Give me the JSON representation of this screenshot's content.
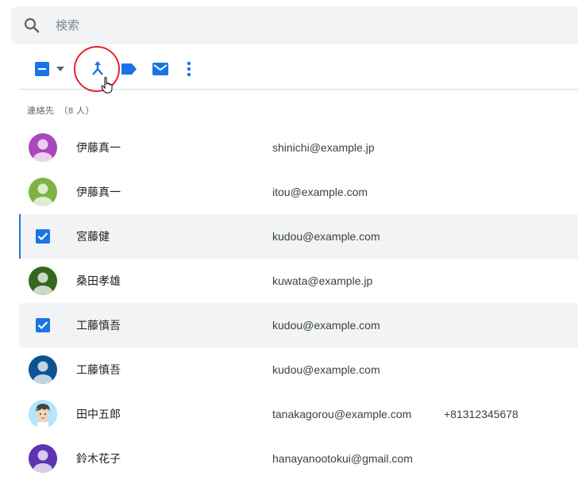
{
  "search": {
    "placeholder": "検索"
  },
  "toolbar": {
    "icons": {
      "select": "checkbox-indeterminate-icon",
      "dropdown": "caret-down-icon",
      "merge": "merge-icon",
      "label": "label-icon",
      "email": "mail-icon",
      "more": "more-vert-icon"
    },
    "accent_color": "#1a73e8",
    "highlight_color": "#e8212b"
  },
  "section": {
    "label": "連絡先",
    "count": "（8 人）"
  },
  "contacts": [
    {
      "name": "伊藤真一",
      "email": "shinichi@example.jp",
      "phone": "",
      "selected": false,
      "avatar_color": "#ab47bc"
    },
    {
      "name": "伊藤真一",
      "email": "itou@example.com",
      "phone": "",
      "selected": false,
      "avatar_color": "#7cb342"
    },
    {
      "name": "宮藤健",
      "email": "kudou@example.com",
      "phone": "",
      "selected": true,
      "avatar_color": "#1a73e8"
    },
    {
      "name": "桑田孝雄",
      "email": "kuwata@example.jp",
      "phone": "",
      "selected": false,
      "avatar_color": "#33691e"
    },
    {
      "name": "工藤慎吾",
      "email": "kudou@example.com",
      "phone": "",
      "selected": true,
      "avatar_color": "#1a73e8"
    },
    {
      "name": "工藤慎吾",
      "email": "kudou@example.com",
      "phone": "",
      "selected": false,
      "avatar_color": "#0b5394"
    },
    {
      "name": "田中五郎",
      "email": "tanakagorou@example.com",
      "phone": "+81312345678",
      "selected": false,
      "avatar_color": "#b3e5fc"
    },
    {
      "name": "鈴木花子",
      "email": "hanayanootokui@gmail.com",
      "phone": "",
      "selected": false,
      "avatar_color": "#5e35b1"
    }
  ]
}
